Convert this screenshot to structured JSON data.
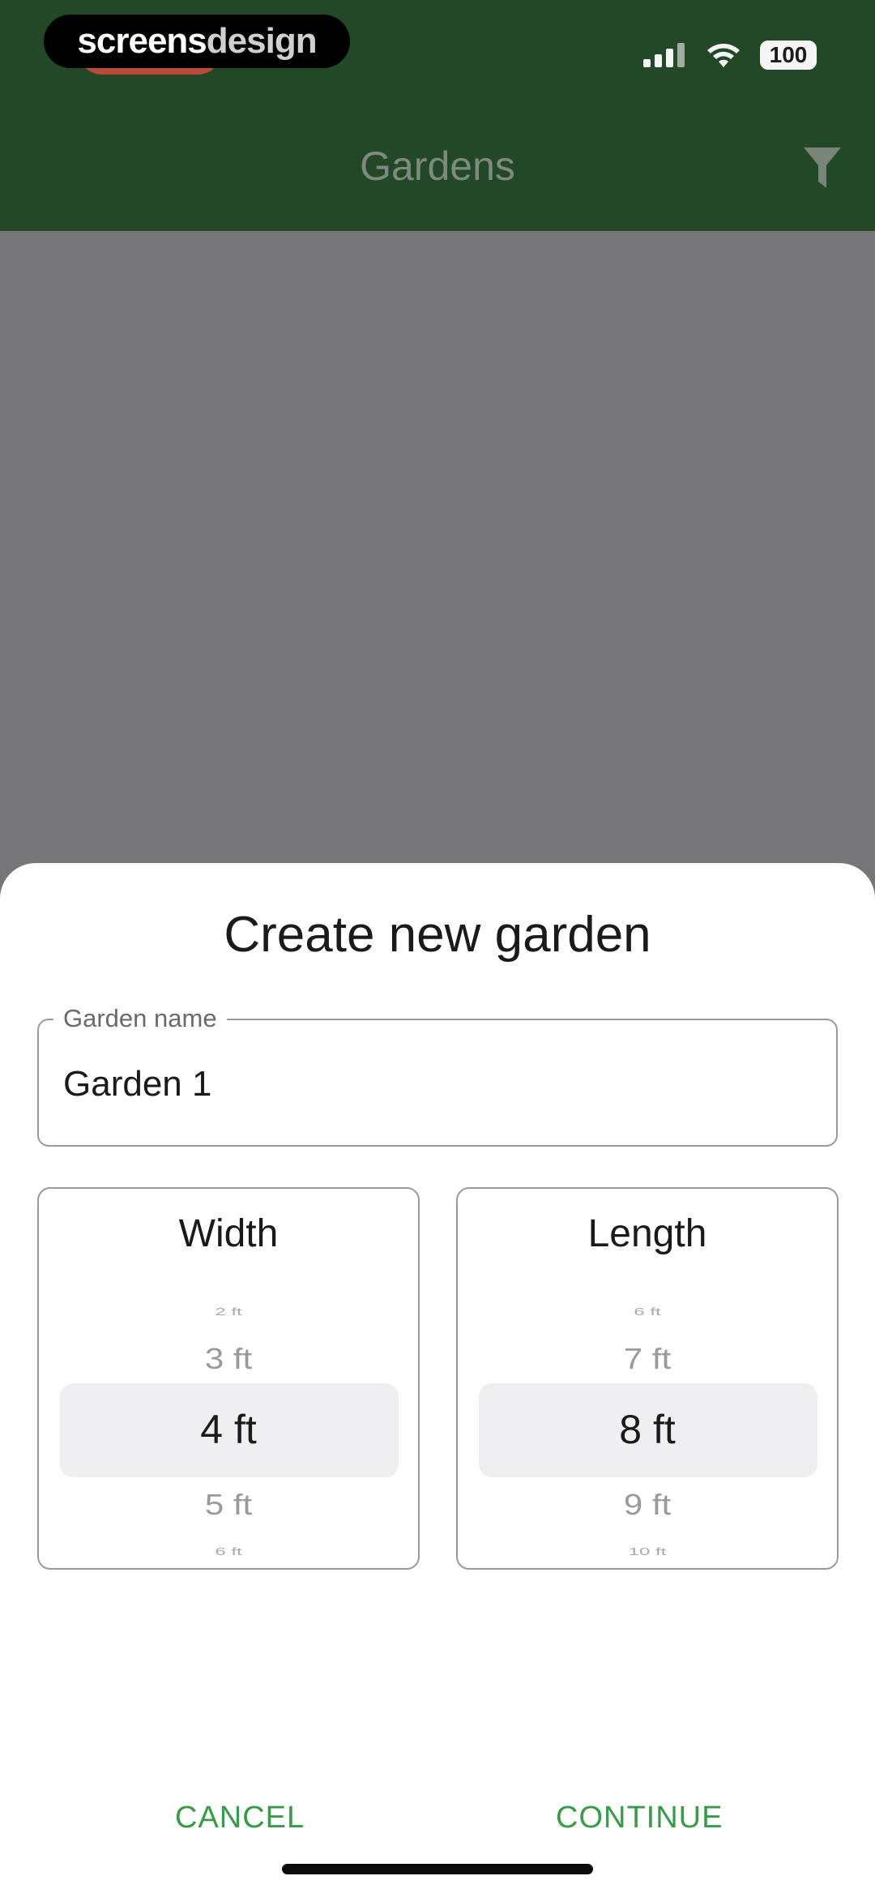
{
  "watermark": {
    "part1": "screens",
    "part2": "design"
  },
  "status_bar": {
    "battery": "100",
    "icons": [
      "cellular-signal-icon",
      "wifi-icon",
      "battery-icon"
    ]
  },
  "app_bar": {
    "title": "Gardens",
    "action_icon": "filter-icon"
  },
  "dialog": {
    "title": "Create new garden",
    "name_field": {
      "label": "Garden name",
      "value": "Garden 1"
    },
    "width_picker": {
      "title": "Width",
      "items": [
        "2 ft",
        "3 ft",
        "4 ft",
        "5 ft",
        "6 ft"
      ],
      "selected": "4 ft"
    },
    "length_picker": {
      "title": "Length",
      "items": [
        "6 ft",
        "7 ft",
        "8 ft",
        "9 ft",
        "10 ft"
      ],
      "selected": "8 ft"
    },
    "cancel_label": "CANCEL",
    "continue_label": "CONTINUE"
  },
  "colors": {
    "app_bar": "#224827",
    "scrim": "#767577",
    "accent": "#3a9a48"
  }
}
